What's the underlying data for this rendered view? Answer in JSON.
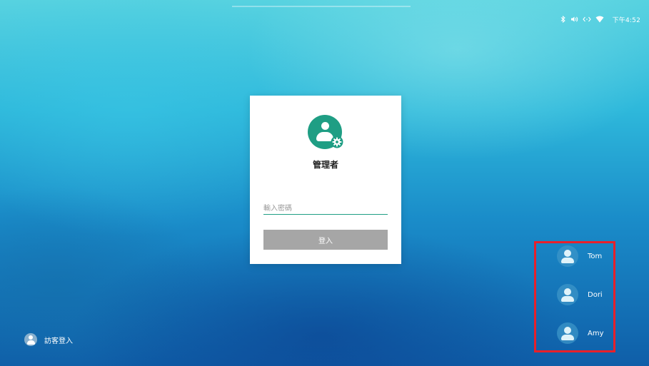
{
  "status_bar": {
    "time": "下午4:52",
    "icons": [
      "bluetooth-icon",
      "volume-icon",
      "ethernet-icon",
      "wifi-icon"
    ]
  },
  "login": {
    "title": "管理者",
    "password_placeholder": "輸入密碼",
    "login_button": "登入",
    "accent_color": "#1f9e84",
    "button_color": "#a6a6a6"
  },
  "guest": {
    "label": "訪客登入"
  },
  "users": [
    {
      "name": "Tom"
    },
    {
      "name": "Dori"
    },
    {
      "name": "Amy"
    }
  ],
  "highlight_color": "#e8202a"
}
